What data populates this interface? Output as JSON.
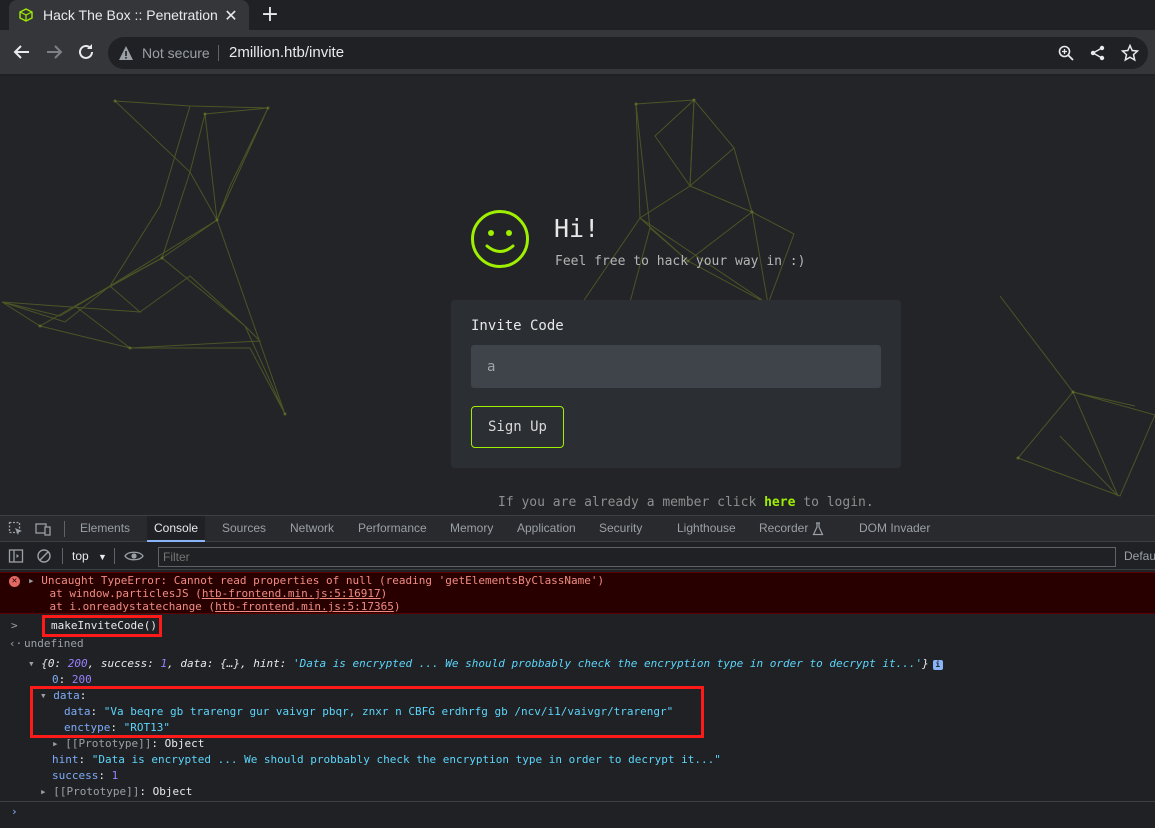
{
  "browser": {
    "tab_title": "Hack The Box :: Penetration",
    "security_label": "Not secure",
    "url": "2million.htb/invite"
  },
  "page": {
    "greeting": "Hi!",
    "subtitle": "Feel free to hack your way in :)",
    "invite_label": "Invite Code",
    "invite_value": "a",
    "signup_label": "Sign Up",
    "login_prefix": "If you are already a member click ",
    "login_link": "here",
    "login_suffix": " to login.",
    "accent_color": "#9fef00"
  },
  "devtools": {
    "tabs": [
      "Elements",
      "Console",
      "Sources",
      "Network",
      "Performance",
      "Memory",
      "Application",
      "Security",
      "Lighthouse",
      "Recorder",
      "DOM Invader"
    ],
    "active_tab": "Console",
    "context": "top",
    "filter_placeholder": "Filter",
    "levels": "Default levels",
    "console": {
      "error_message": "Uncaught TypeError: Cannot read properties of null (reading 'getElementsByClassName')",
      "error_at1_prefix": "    at window.particlesJS (",
      "error_at1_link": "htb-frontend.min.js:5:16917",
      "error_at1_suffix": ")",
      "error_at2_prefix": "    at i.onreadystatechange (",
      "error_at2_link": "htb-frontend.min.js:5:17365",
      "error_at2_suffix": ")",
      "command": "makeInviteCode()",
      "return_value": "undefined",
      "obj_summary_open": "{0: ",
      "obj_summary_200": "200",
      "obj_summary_mid1": ", success: ",
      "obj_summary_1": "1",
      "obj_summary_mid2": ", data: {…}, hint: ",
      "obj_summary_hint": "'Data is encrypted ... We should probbably check the encryption type in order to decrypt it...'",
      "obj_summary_close": "}",
      "key_0": "0",
      "val_0": "200",
      "key_data": "data",
      "key_data_data": "data",
      "val_data_data": "\"Va beqre gb trarengr gur vaivgr pbqr, znxr n CBFG erdhrfg gb /ncv/i1/vaivgr/trarengr\"",
      "key_enctype": "enctype",
      "val_enctype": "\"ROT13\"",
      "proto_label": "[[Prototype]]",
      "proto_value": "Object",
      "key_hint": "hint",
      "val_hint": "\"Data is encrypted ... We should probbably check the encryption type in order to decrypt it...\"",
      "key_success": "success",
      "val_success": "1"
    }
  }
}
